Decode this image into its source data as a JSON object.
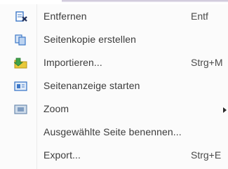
{
  "menu": {
    "items": [
      {
        "label": "Entfernen",
        "shortcut": "Entf",
        "icon": "delete-page-icon"
      },
      {
        "label": "Seitenkopie erstellen",
        "shortcut": "",
        "icon": "page-copy-icon"
      },
      {
        "label": "Importieren...",
        "shortcut": "Strg+M",
        "icon": "import-folder-icon"
      },
      {
        "label": "Seitenanzeige starten",
        "shortcut": "",
        "icon": "slideshow-icon"
      },
      {
        "label": "Zoom",
        "shortcut": "",
        "icon": "zoom-icon",
        "submenu": true
      },
      {
        "label": "Ausgewählte Seite benennen...",
        "shortcut": "",
        "icon": ""
      },
      {
        "label": "Export...",
        "shortcut": "Strg+E",
        "icon": ""
      }
    ]
  },
  "colors": {
    "menu_background": "#fbfbfb",
    "text": "#3b3b3b",
    "icon_blue": "#3d78c8",
    "icon_yellow": "#e8c93a",
    "icon_green": "#3fa34a"
  }
}
